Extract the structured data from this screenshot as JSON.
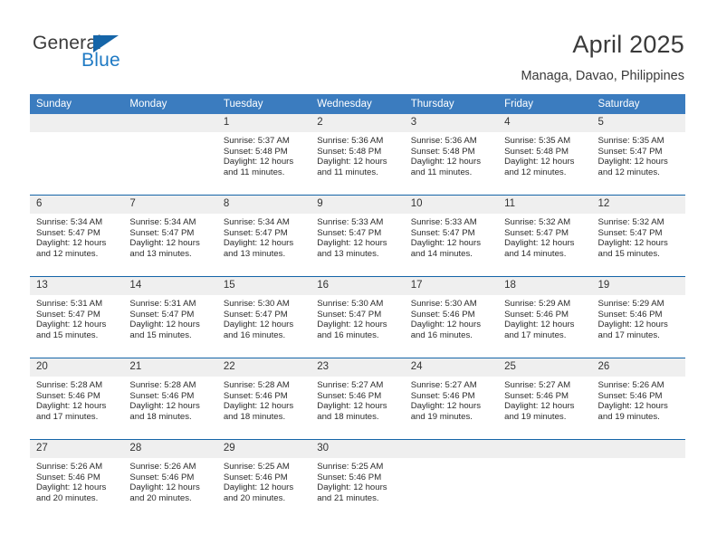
{
  "brand": {
    "name_part1": "General",
    "name_part2": "Blue",
    "logo_icon": "triangle-icon",
    "color_dark": "#3b3b3b",
    "color_blue": "#1f7ac4"
  },
  "header": {
    "title": "April 2025",
    "subtitle": "Managa, Davao, Philippines"
  },
  "theme": {
    "header_blue": "#3b7cbf",
    "rule_blue": "#1565a8",
    "daynum_gray": "#efefef"
  },
  "calendar": {
    "weekday_headers": [
      "Sunday",
      "Monday",
      "Tuesday",
      "Wednesday",
      "Thursday",
      "Friday",
      "Saturday"
    ],
    "labels": {
      "sunrise": "Sunrise:",
      "sunset": "Sunset:",
      "daylight": "Daylight:"
    },
    "weeks": [
      [
        {
          "day": "",
          "sunrise": "",
          "sunset": "",
          "daylight": "",
          "blank": true
        },
        {
          "day": "",
          "sunrise": "",
          "sunset": "",
          "daylight": "",
          "blank": true
        },
        {
          "day": "1",
          "sunrise": "Sunrise: 5:37 AM",
          "sunset": "Sunset: 5:48 PM",
          "daylight": "Daylight: 12 hours and 11 minutes."
        },
        {
          "day": "2",
          "sunrise": "Sunrise: 5:36 AM",
          "sunset": "Sunset: 5:48 PM",
          "daylight": "Daylight: 12 hours and 11 minutes."
        },
        {
          "day": "3",
          "sunrise": "Sunrise: 5:36 AM",
          "sunset": "Sunset: 5:48 PM",
          "daylight": "Daylight: 12 hours and 11 minutes."
        },
        {
          "day": "4",
          "sunrise": "Sunrise: 5:35 AM",
          "sunset": "Sunset: 5:48 PM",
          "daylight": "Daylight: 12 hours and 12 minutes."
        },
        {
          "day": "5",
          "sunrise": "Sunrise: 5:35 AM",
          "sunset": "Sunset: 5:47 PM",
          "daylight": "Daylight: 12 hours and 12 minutes."
        }
      ],
      [
        {
          "day": "6",
          "sunrise": "Sunrise: 5:34 AM",
          "sunset": "Sunset: 5:47 PM",
          "daylight": "Daylight: 12 hours and 12 minutes."
        },
        {
          "day": "7",
          "sunrise": "Sunrise: 5:34 AM",
          "sunset": "Sunset: 5:47 PM",
          "daylight": "Daylight: 12 hours and 13 minutes."
        },
        {
          "day": "8",
          "sunrise": "Sunrise: 5:34 AM",
          "sunset": "Sunset: 5:47 PM",
          "daylight": "Daylight: 12 hours and 13 minutes."
        },
        {
          "day": "9",
          "sunrise": "Sunrise: 5:33 AM",
          "sunset": "Sunset: 5:47 PM",
          "daylight": "Daylight: 12 hours and 13 minutes."
        },
        {
          "day": "10",
          "sunrise": "Sunrise: 5:33 AM",
          "sunset": "Sunset: 5:47 PM",
          "daylight": "Daylight: 12 hours and 14 minutes."
        },
        {
          "day": "11",
          "sunrise": "Sunrise: 5:32 AM",
          "sunset": "Sunset: 5:47 PM",
          "daylight": "Daylight: 12 hours and 14 minutes."
        },
        {
          "day": "12",
          "sunrise": "Sunrise: 5:32 AM",
          "sunset": "Sunset: 5:47 PM",
          "daylight": "Daylight: 12 hours and 15 minutes."
        }
      ],
      [
        {
          "day": "13",
          "sunrise": "Sunrise: 5:31 AM",
          "sunset": "Sunset: 5:47 PM",
          "daylight": "Daylight: 12 hours and 15 minutes."
        },
        {
          "day": "14",
          "sunrise": "Sunrise: 5:31 AM",
          "sunset": "Sunset: 5:47 PM",
          "daylight": "Daylight: 12 hours and 15 minutes."
        },
        {
          "day": "15",
          "sunrise": "Sunrise: 5:30 AM",
          "sunset": "Sunset: 5:47 PM",
          "daylight": "Daylight: 12 hours and 16 minutes."
        },
        {
          "day": "16",
          "sunrise": "Sunrise: 5:30 AM",
          "sunset": "Sunset: 5:47 PM",
          "daylight": "Daylight: 12 hours and 16 minutes."
        },
        {
          "day": "17",
          "sunrise": "Sunrise: 5:30 AM",
          "sunset": "Sunset: 5:46 PM",
          "daylight": "Daylight: 12 hours and 16 minutes."
        },
        {
          "day": "18",
          "sunrise": "Sunrise: 5:29 AM",
          "sunset": "Sunset: 5:46 PM",
          "daylight": "Daylight: 12 hours and 17 minutes."
        },
        {
          "day": "19",
          "sunrise": "Sunrise: 5:29 AM",
          "sunset": "Sunset: 5:46 PM",
          "daylight": "Daylight: 12 hours and 17 minutes."
        }
      ],
      [
        {
          "day": "20",
          "sunrise": "Sunrise: 5:28 AM",
          "sunset": "Sunset: 5:46 PM",
          "daylight": "Daylight: 12 hours and 17 minutes."
        },
        {
          "day": "21",
          "sunrise": "Sunrise: 5:28 AM",
          "sunset": "Sunset: 5:46 PM",
          "daylight": "Daylight: 12 hours and 18 minutes."
        },
        {
          "day": "22",
          "sunrise": "Sunrise: 5:28 AM",
          "sunset": "Sunset: 5:46 PM",
          "daylight": "Daylight: 12 hours and 18 minutes."
        },
        {
          "day": "23",
          "sunrise": "Sunrise: 5:27 AM",
          "sunset": "Sunset: 5:46 PM",
          "daylight": "Daylight: 12 hours and 18 minutes."
        },
        {
          "day": "24",
          "sunrise": "Sunrise: 5:27 AM",
          "sunset": "Sunset: 5:46 PM",
          "daylight": "Daylight: 12 hours and 19 minutes."
        },
        {
          "day": "25",
          "sunrise": "Sunrise: 5:27 AM",
          "sunset": "Sunset: 5:46 PM",
          "daylight": "Daylight: 12 hours and 19 minutes."
        },
        {
          "day": "26",
          "sunrise": "Sunrise: 5:26 AM",
          "sunset": "Sunset: 5:46 PM",
          "daylight": "Daylight: 12 hours and 19 minutes."
        }
      ],
      [
        {
          "day": "27",
          "sunrise": "Sunrise: 5:26 AM",
          "sunset": "Sunset: 5:46 PM",
          "daylight": "Daylight: 12 hours and 20 minutes."
        },
        {
          "day": "28",
          "sunrise": "Sunrise: 5:26 AM",
          "sunset": "Sunset: 5:46 PM",
          "daylight": "Daylight: 12 hours and 20 minutes."
        },
        {
          "day": "29",
          "sunrise": "Sunrise: 5:25 AM",
          "sunset": "Sunset: 5:46 PM",
          "daylight": "Daylight: 12 hours and 20 minutes."
        },
        {
          "day": "30",
          "sunrise": "Sunrise: 5:25 AM",
          "sunset": "Sunset: 5:46 PM",
          "daylight": "Daylight: 12 hours and 21 minutes."
        },
        {
          "day": "",
          "sunrise": "",
          "sunset": "",
          "daylight": "",
          "blank": true
        },
        {
          "day": "",
          "sunrise": "",
          "sunset": "",
          "daylight": "",
          "blank": true
        },
        {
          "day": "",
          "sunrise": "",
          "sunset": "",
          "daylight": "",
          "blank": true
        }
      ]
    ]
  }
}
